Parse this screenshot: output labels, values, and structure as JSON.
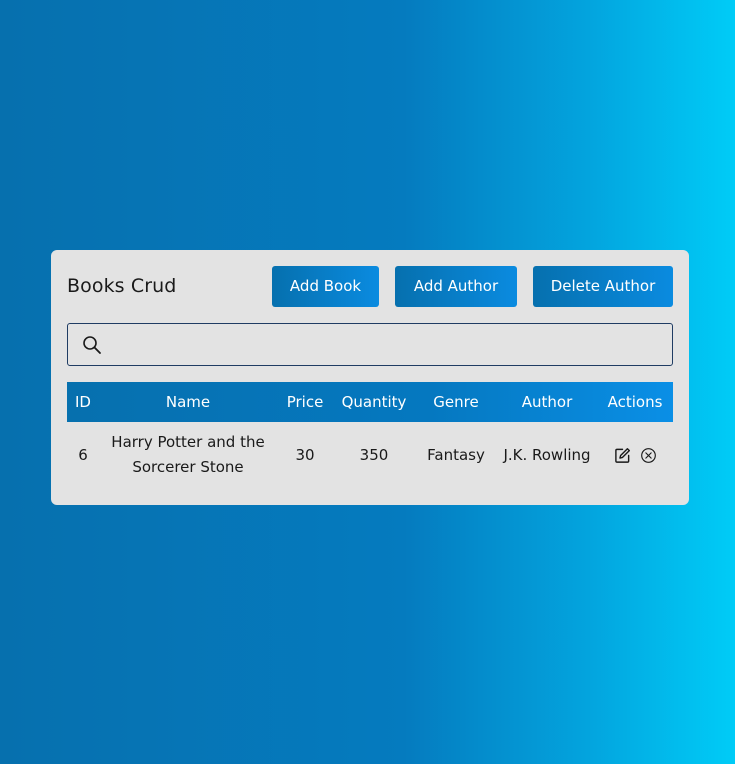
{
  "header": {
    "title": "Books Crud",
    "add_book_label": "Add Book",
    "add_author_label": "Add Author",
    "delete_author_label": "Delete Author"
  },
  "search": {
    "placeholder": "",
    "value": "",
    "icon": "search-icon"
  },
  "table": {
    "columns": [
      "ID",
      "Name",
      "Price",
      "Quantity",
      "Genre",
      "Author",
      "Actions"
    ],
    "rows": [
      {
        "id": "6",
        "name": "Harry Potter and the Sorcerer Stone",
        "price": "30",
        "quantity": "350",
        "genre": "Fantasy",
        "author": "J.K. Rowling",
        "actions": [
          "edit-icon",
          "delete-icon"
        ]
      }
    ]
  },
  "colors": {
    "background_start": "#0670ae",
    "background_end": "#00ccf7",
    "card": "#e3e3e3",
    "button": "#0670ae",
    "search_border": "#1f3c63"
  }
}
